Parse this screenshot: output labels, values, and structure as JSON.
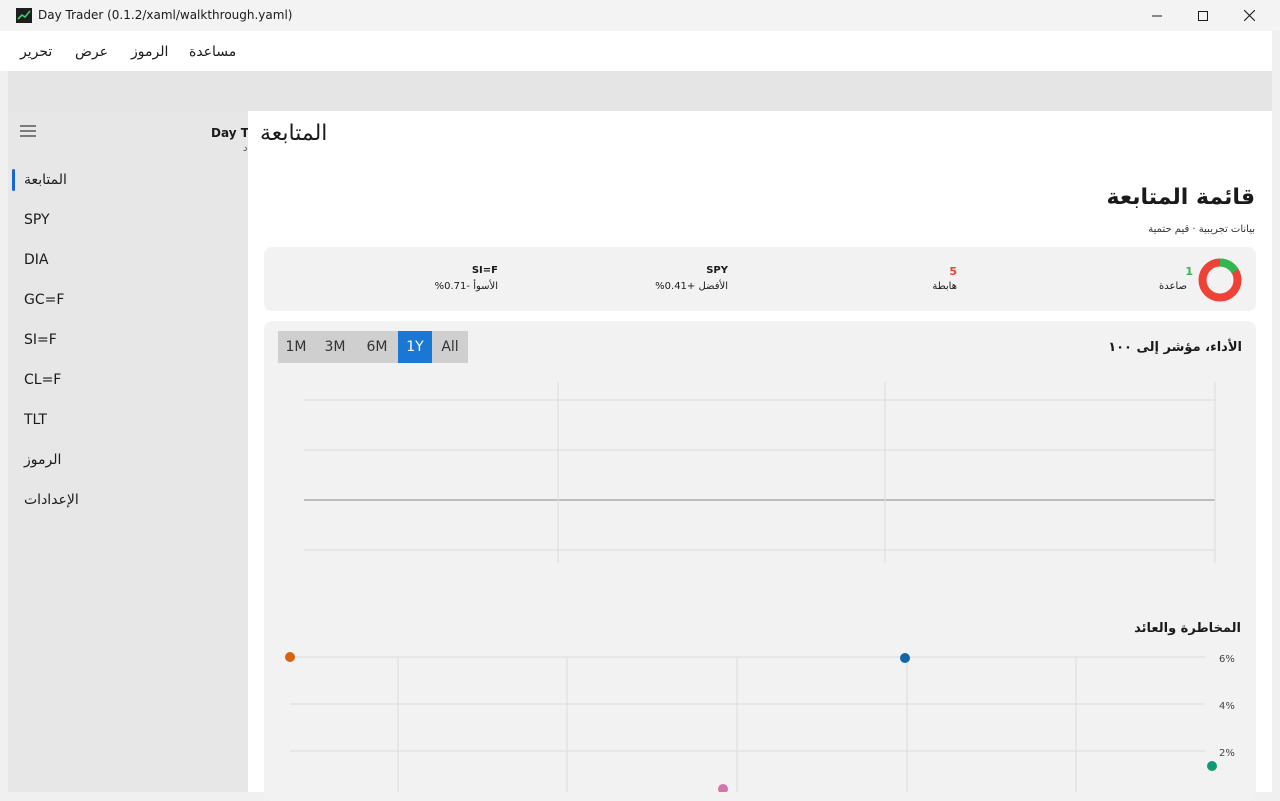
{
  "window": {
    "title": "Day Trader (0.1.2/xaml/walkthrough.yaml)",
    "controls": [
      "minimize-icon",
      "maximize-icon",
      "close-icon"
    ]
  },
  "menu": {
    "items": [
      "تحرير",
      "عرض",
      "الرموز",
      "مساعدة"
    ]
  },
  "nav": {
    "brand_title": "Day Tr",
    "brand_sub": "د",
    "items": [
      {
        "label": "المتابعة",
        "selected": true
      },
      {
        "label": "SPY"
      },
      {
        "label": "DIA"
      },
      {
        "label": "GC=F"
      },
      {
        "label": "SI=F"
      },
      {
        "label": "CL=F"
      },
      {
        "label": "TLT"
      },
      {
        "label": "الرموز"
      },
      {
        "label": "الإعدادات"
      }
    ]
  },
  "page": {
    "header": "المتابعة",
    "title": "قائمة المتابعة",
    "subtitle": "بيانات تجريبية · قيم حتمية"
  },
  "summary": {
    "up_count": "1",
    "up_label": "صاعدة",
    "down_count": "5",
    "down_label": "هابطة",
    "best_symbol": "SPY",
    "best_label": "الأفضل +0.41%",
    "worst_symbol": "SI=F",
    "worst_label": "الأسوأ -0.71%",
    "donut": {
      "up_fraction": 0.1667,
      "up_color": "#2fb84f",
      "down_color": "#ef4136"
    }
  },
  "performance": {
    "title": "الأداء، مؤشر إلى ١٠٠",
    "ranges": [
      "1M",
      "3M",
      "6M",
      "1Y",
      "All"
    ],
    "selected_range": "1Y"
  },
  "risk_return": {
    "title": "المخاطرة والعائد",
    "y_ticks": [
      "6%",
      "4%",
      "2%"
    ],
    "colors": [
      "#d9620f",
      "#1066a8",
      "#0f9a73",
      "#d673b0"
    ]
  }
}
